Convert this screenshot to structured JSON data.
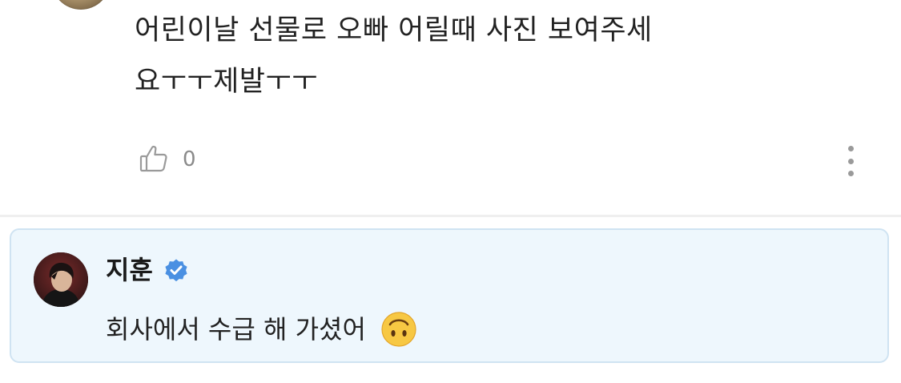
{
  "comment": {
    "lines": [
      "어린이날 선물로 오빠 어릴때 사진 보여주세",
      "요ㅜㅜ제발ㅜㅜ"
    ],
    "like_count": "0",
    "like_icon": "thumbs-up-icon",
    "more_icon": "more-vertical-icon"
  },
  "reply": {
    "author": "지훈",
    "verified_icon": "verified-badge-icon",
    "text": "회사에서 수급 해 가셨어",
    "emoji_icon": "upside-down-face-emoji",
    "colors": {
      "background": "#eef7fd",
      "border": "#cfe3f2",
      "badge": "#4a90e2"
    }
  }
}
